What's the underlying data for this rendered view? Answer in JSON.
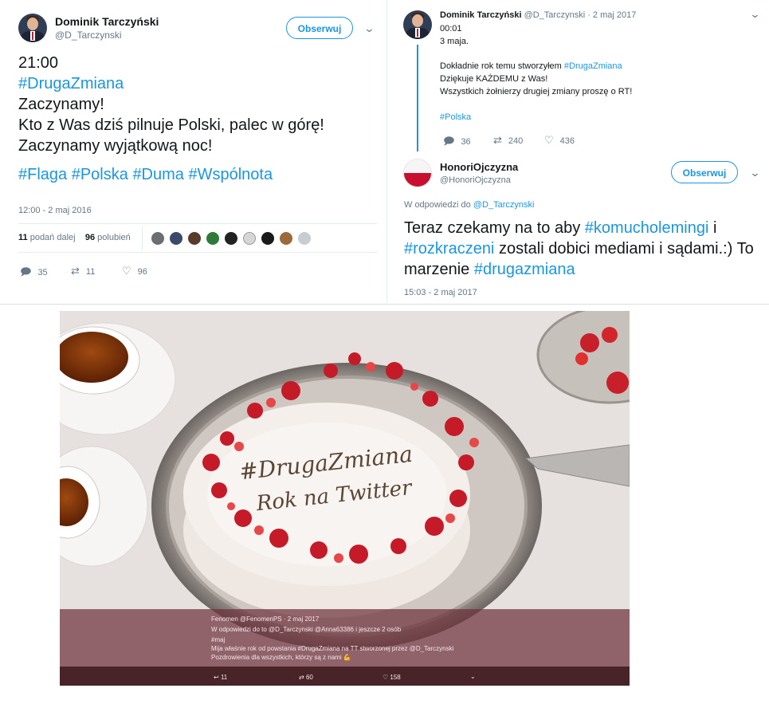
{
  "tweet1": {
    "author_name": "Dominik Tarczyński",
    "author_handle": "@D_Tarczynski",
    "follow_label": "Obserwuj",
    "text_lines": [
      "21:00",
      "#DrugaZmiana",
      "Zaczynamy!",
      "Kto z Was dziś pilnuje Polski, palec w górę!",
      "Zaczynamy wyjątkową noc!"
    ],
    "hashtags_line": [
      "#Flaga",
      "#Polska",
      "#Duma",
      "#Wspólnota"
    ],
    "timestamp": "12:00 - 2 maj 2016",
    "retweets_count": "11",
    "retweets_label": "podań dalej",
    "likes_count": "96",
    "likes_label": "polubień",
    "actions": {
      "reply": "35",
      "retweet": "11",
      "like": "96"
    }
  },
  "tweet2": {
    "author_name": "Dominik Tarczyński",
    "author_handle": "@D_Tarczynski",
    "date": "· 2 maj 2017",
    "lines": [
      "00:01",
      "3 maja.",
      "",
      "Dokładnie rok temu stworzyłem",
      "Dziękuje KAŻDEMU z Was!",
      "Wszystkich żołnierzy drugiej zmiany proszę o RT!",
      "",
      "#Polska"
    ],
    "inline_hashtag": "#DrugaZmiana",
    "actions": {
      "reply": "36",
      "retweet": "240",
      "like": "436"
    }
  },
  "tweet3": {
    "author_name": "HonoriOjczyzna",
    "author_handle": "@HonoriOjczyzna",
    "follow_label": "Obserwuj",
    "reply_to_label": "W odpowiedzi do",
    "reply_to_handle": "@D_Tarczynski",
    "text_a": "Teraz czekamy na to aby",
    "hashtag_a": "#komucholemingi",
    "text_b": "i",
    "hashtag_b": "#rozkraczeni",
    "text_c": "zostali dobici mediami i sądami.:) To marzenie",
    "hashtag_c": "#drugazmiana",
    "timestamp": "15:03 - 2 maj 2017"
  },
  "photo": {
    "cake_line1": "#DrugaZmiana",
    "cake_line2": "Rok na Twitter",
    "overlay_author": "Fenomen @FenomenPS · 2 maj 2017",
    "overlay_reply": "W odpowiedzi do to @D_Tarczynski @Anna63386 i jeszcze 2 osób",
    "overlay_line1": "#maj",
    "overlay_line2": "Mija właśnie rok od powstania #DrugaZmiana na TT stworzonej przez @D_Tarczynski",
    "overlay_line3": "Pozdrowienia dla wszystkich, którzy są z nami 💪",
    "overlay_actions": {
      "reply": "11",
      "retweet": "60",
      "like": "158"
    }
  },
  "colors": {
    "link": "#1b95e0",
    "muted": "#657786",
    "text": "#14171a"
  },
  "icons": [
    "reply-icon",
    "retweet-icon",
    "heart-icon",
    "chevron-down-icon"
  ]
}
